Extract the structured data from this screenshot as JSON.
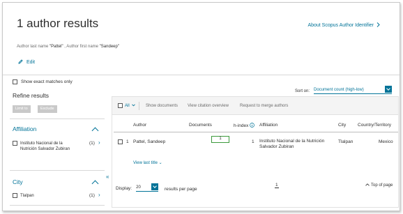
{
  "header": {
    "title": "1 author results",
    "about_link": "About Scopus Author Identifier",
    "query_prefix": "Author last name ",
    "last_name": "\"Pattel\"",
    "query_middle": " , Author first name ",
    "first_name": "\"Sandeep\"",
    "edit_label": "Edit"
  },
  "sidebar": {
    "exact_matches": "Show exact matches only",
    "refine_title": "Refine results",
    "limit_to": "Limit to",
    "exclude": "Exclude",
    "affiliation": {
      "title": "Affiliation",
      "items": [
        {
          "label": "Instituto Nacional de la Nutrición Salvador Zubiran",
          "count": "(1)"
        }
      ]
    },
    "city": {
      "title": "City",
      "items": [
        {
          "label": "Tlalpan",
          "count": "(1)"
        }
      ]
    }
  },
  "sort": {
    "label": "Sort on:",
    "value": "Document count (high-low)"
  },
  "toolbar": {
    "all": "All",
    "show_documents": "Show documents",
    "view_citation": "View citation overview",
    "request_merge": "Request to merge authors"
  },
  "table": {
    "columns": [
      "Author",
      "Documents",
      "h-index",
      "Affiliation",
      "City",
      "Country/Territory"
    ],
    "rows": [
      {
        "index": "1",
        "author": "Pattel, Sandeep",
        "documents": "1",
        "h_index": "1",
        "affiliation": "Instituto Nacional de la Nutrición Salvador Zubiran",
        "city": "Tlalpan",
        "country": "Mexico"
      }
    ],
    "view_last_title": "View last title"
  },
  "footer": {
    "display_label": "Display:",
    "display_value": "20",
    "results_per_page": "results per page",
    "page": "1",
    "top_of_page": "Top of page"
  },
  "colors": {
    "accent": "#007398",
    "highlight": "#3b9a3b"
  }
}
